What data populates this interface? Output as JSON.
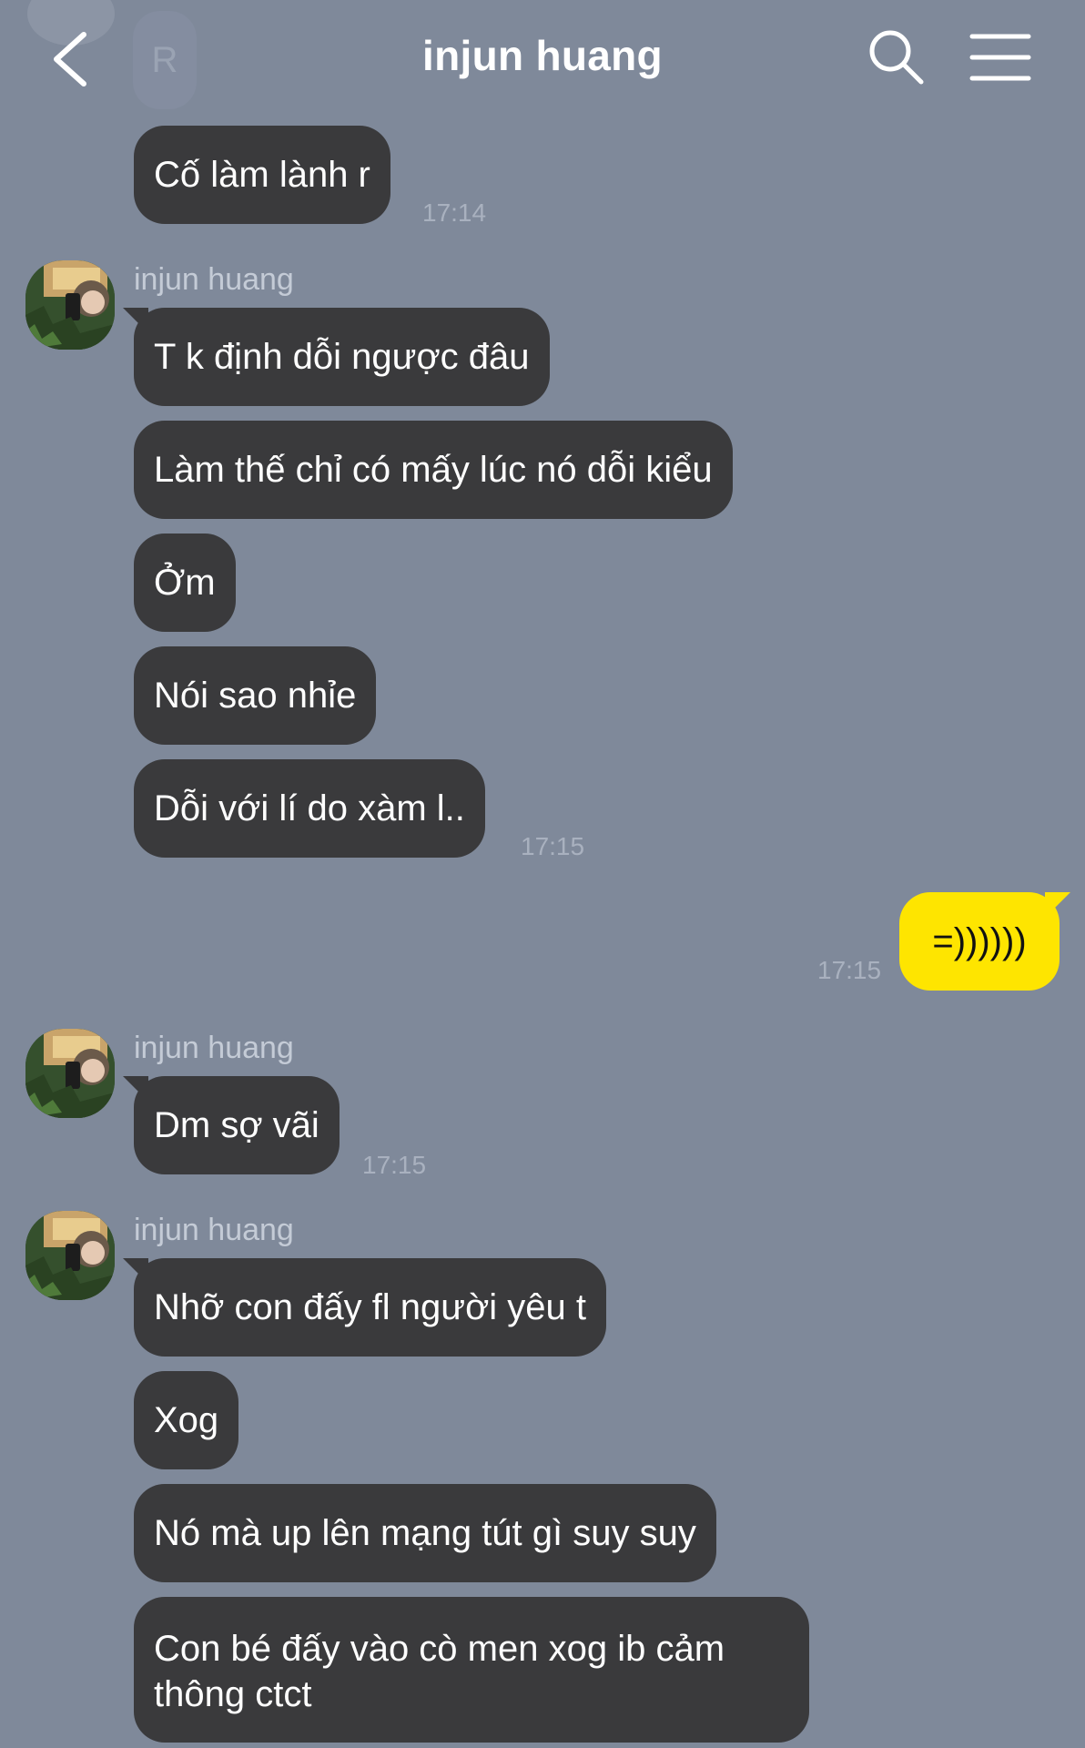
{
  "header": {
    "title": "injun huang",
    "back_icon": "chevron-left-icon",
    "search_icon": "search-icon",
    "menu_icon": "hamburger-menu-icon"
  },
  "top_partial": {
    "avatar_letter": "R"
  },
  "colors": {
    "background": "#7f899a",
    "bubble_other": "#3a3a3c",
    "bubble_me": "#fee500",
    "text_light": "#ffffff",
    "timestamp": "#a9b1bf"
  },
  "messages": {
    "m0": {
      "text": "Cố làm lành r",
      "time": "17:14"
    },
    "g1": {
      "sender": "injun huang",
      "m1": {
        "text": "T k định dỗi ngược đâu"
      },
      "m2": {
        "text": "Làm thế chỉ có mấy lúc nó dỗi kiểu"
      },
      "m3": {
        "text": "Ởm"
      },
      "m4": {
        "text": "Nói sao nhỉe"
      },
      "m5": {
        "text": "Dỗi với lí do xàm l..",
        "time": "17:15"
      }
    },
    "me1": {
      "text": "=))))))",
      "time": "17:15"
    },
    "g2": {
      "sender": "injun huang",
      "m1": {
        "text": "Dm sợ vãi",
        "time": "17:15"
      }
    },
    "g3": {
      "sender": "injun huang",
      "m1": {
        "text": "Nhỡ con đấy fl người yêu t"
      },
      "m2": {
        "text": "Xog"
      },
      "m3": {
        "text": "Nó mà up lên mạng tút gì suy suy"
      },
      "m4": {
        "text": "Con bé đấy vào cò men xog ib cảm thông ctct"
      }
    }
  }
}
